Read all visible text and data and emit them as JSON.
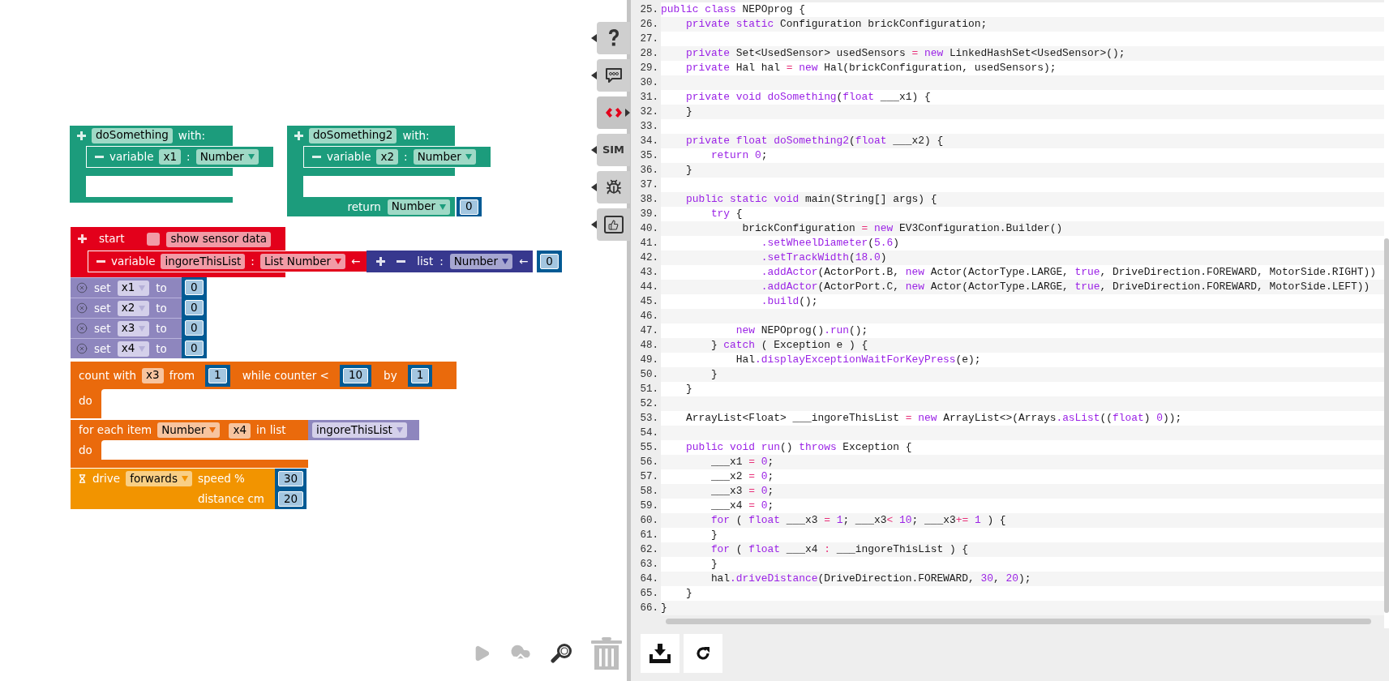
{
  "functions": [
    {
      "name": "doSomething",
      "with": "with:",
      "parameter": {
        "label": "variable",
        "name": "x1",
        "separator": ":",
        "type": "Number"
      }
    },
    {
      "name": "doSomething2",
      "with": "with:",
      "parameter": {
        "label": "variable",
        "name": "x2",
        "separator": ":",
        "type": "Number"
      },
      "return": {
        "label": "return",
        "type": "Number",
        "value": "0"
      }
    }
  ],
  "start": {
    "label": "start",
    "show_sensor_data": {
      "checked": false,
      "label": "show sensor data"
    },
    "variable": {
      "label": "variable",
      "name": "ingoreThisList",
      "separator": ":",
      "type": "List Number",
      "arrow": "←",
      "list": {
        "label": "list",
        "separator": ":",
        "type": "Number",
        "arrow": "←",
        "value": "0"
      }
    }
  },
  "set_blocks": [
    {
      "label": "set",
      "variable": "x1",
      "to": "to",
      "value": "0"
    },
    {
      "label": "set",
      "variable": "x2",
      "to": "to",
      "value": "0"
    },
    {
      "label": "set",
      "variable": "x3",
      "to": "to",
      "value": "0"
    },
    {
      "label": "set",
      "variable": "x4",
      "to": "to",
      "value": "0"
    }
  ],
  "count_loop": {
    "label": "count with",
    "variable": "x3",
    "from": "from",
    "start": "1",
    "condition": "while counter <",
    "end": "10",
    "by": "by",
    "step": "1",
    "do": "do"
  },
  "for_each": {
    "label": "for each item",
    "type": "Number",
    "variable": "x4",
    "in_list": "in list",
    "list": "ingoreThisList",
    "do": "do"
  },
  "drive": {
    "label": "drive",
    "direction": "forwards",
    "speed_label": "speed %",
    "speed": "30",
    "distance_label": "distance cm",
    "distance": "20"
  },
  "tool_tabs": [
    {
      "kind": "help",
      "selected": false
    },
    {
      "kind": "comment",
      "selected": false
    },
    {
      "kind": "code",
      "selected": true
    },
    {
      "kind": "sim",
      "label": "SIM",
      "selected": false
    },
    {
      "kind": "debug",
      "selected": false
    },
    {
      "kind": "feedback",
      "selected": false
    }
  ],
  "code": {
    "lines": [
      {
        "number": "25.",
        "tokens": [
          {
            "kind": "kw",
            "text": "public class"
          },
          {
            "kind": "txt",
            "text": " NEPOprog {"
          }
        ]
      },
      {
        "number": "26.",
        "tokens": [
          {
            "kind": "kw",
            "text": "    private static"
          },
          {
            "kind": "txt",
            "text": " Configuration brickConfiguration;"
          }
        ]
      },
      {
        "number": "27."
      },
      {
        "number": "28.",
        "tokens": [
          {
            "kind": "kw",
            "text": "    private"
          },
          {
            "kind": "txt",
            "text": " Set<UsedSensor> usedSensors "
          },
          {
            "kind": "op",
            "text": "="
          },
          {
            "kind": "kw",
            "text": " new"
          },
          {
            "kind": "txt",
            "text": " LinkedHashSet<UsedSensor>();"
          }
        ]
      },
      {
        "number": "29.",
        "tokens": [
          {
            "kind": "kw",
            "text": "    private"
          },
          {
            "kind": "txt",
            "text": " Hal hal "
          },
          {
            "kind": "op",
            "text": "="
          },
          {
            "kind": "kw",
            "text": " new"
          },
          {
            "kind": "txt",
            "text": " Hal(brickConfiguration, usedSensors);"
          }
        ]
      },
      {
        "number": "30."
      },
      {
        "number": "31.",
        "tokens": [
          {
            "kind": "kw",
            "text": "    private void doSomething"
          },
          {
            "kind": "txt",
            "text": "("
          },
          {
            "kind": "kw",
            "text": "float"
          },
          {
            "kind": "txt",
            "text": " ___x1) {"
          }
        ]
      },
      {
        "number": "32.",
        "tokens": [
          {
            "kind": "txt",
            "text": "    }"
          }
        ]
      },
      {
        "number": "33."
      },
      {
        "number": "34.",
        "tokens": [
          {
            "kind": "kw",
            "text": "    private float doSomething2"
          },
          {
            "kind": "txt",
            "text": "("
          },
          {
            "kind": "kw",
            "text": "float"
          },
          {
            "kind": "txt",
            "text": " ___x2) {"
          }
        ]
      },
      {
        "number": "35.",
        "tokens": [
          {
            "kind": "kw",
            "text": "        return 0"
          },
          {
            "kind": "txt",
            "text": ";"
          }
        ]
      },
      {
        "number": "36.",
        "tokens": [
          {
            "kind": "txt",
            "text": "    }"
          }
        ]
      },
      {
        "number": "37."
      },
      {
        "number": "38.",
        "tokens": [
          {
            "kind": "kw",
            "text": "    public static void"
          },
          {
            "kind": "txt",
            "text": " main(String[] args) {"
          }
        ]
      },
      {
        "number": "39.",
        "tokens": [
          {
            "kind": "kw",
            "text": "        try"
          },
          {
            "kind": "txt",
            "text": " {"
          }
        ]
      },
      {
        "number": "40.",
        "tokens": [
          {
            "kind": "txt",
            "text": "             brickConfiguration "
          },
          {
            "kind": "op",
            "text": "="
          },
          {
            "kind": "kw",
            "text": " new"
          },
          {
            "kind": "txt",
            "text": " EV3Configuration.Builder()"
          }
        ]
      },
      {
        "number": "41.",
        "tokens": [
          {
            "kind": "kw",
            "text": "                .setWheelDiameter"
          },
          {
            "kind": "txt",
            "text": "("
          },
          {
            "kind": "kw",
            "text": "5.6"
          },
          {
            "kind": "txt",
            "text": ")"
          }
        ]
      },
      {
        "number": "42.",
        "tokens": [
          {
            "kind": "kw",
            "text": "                .setTrackWidth"
          },
          {
            "kind": "txt",
            "text": "("
          },
          {
            "kind": "kw",
            "text": "18.0"
          },
          {
            "kind": "txt",
            "text": ")"
          }
        ]
      },
      {
        "number": "43.",
        "tokens": [
          {
            "kind": "kw",
            "text": "                .addActor"
          },
          {
            "kind": "txt",
            "text": "(ActorPort.B, "
          },
          {
            "kind": "kw",
            "text": "new"
          },
          {
            "kind": "txt",
            "text": " Actor(ActorType.LARGE, "
          },
          {
            "kind": "kw",
            "text": "true"
          },
          {
            "kind": "txt",
            "text": ", DriveDirection.FOREWARD, MotorSide.RIGHT))"
          }
        ]
      },
      {
        "number": "44.",
        "tokens": [
          {
            "kind": "kw",
            "text": "                .addActor"
          },
          {
            "kind": "txt",
            "text": "(ActorPort.C, "
          },
          {
            "kind": "kw",
            "text": "new"
          },
          {
            "kind": "txt",
            "text": " Actor(ActorType.LARGE, "
          },
          {
            "kind": "kw",
            "text": "true"
          },
          {
            "kind": "txt",
            "text": ", DriveDirection.FOREWARD, MotorSide.LEFT))"
          }
        ]
      },
      {
        "number": "45.",
        "tokens": [
          {
            "kind": "kw",
            "text": "                .build"
          },
          {
            "kind": "txt",
            "text": "();"
          }
        ]
      },
      {
        "number": "46."
      },
      {
        "number": "47.",
        "tokens": [
          {
            "kind": "kw",
            "text": "            new"
          },
          {
            "kind": "txt",
            "text": " NEPOprog()"
          },
          {
            "kind": "kw",
            "text": ".run"
          },
          {
            "kind": "txt",
            "text": "();"
          }
        ]
      },
      {
        "number": "48.",
        "tokens": [
          {
            "kind": "txt",
            "text": "        } "
          },
          {
            "kind": "kw",
            "text": "catch"
          },
          {
            "kind": "txt",
            "text": " ( Exception e ) {"
          }
        ]
      },
      {
        "number": "49.",
        "tokens": [
          {
            "kind": "txt",
            "text": "            Hal"
          },
          {
            "kind": "kw",
            "text": ".displayExceptionWaitForKeyPress"
          },
          {
            "kind": "txt",
            "text": "(e);"
          }
        ]
      },
      {
        "number": "50.",
        "tokens": [
          {
            "kind": "txt",
            "text": "        }"
          }
        ]
      },
      {
        "number": "51.",
        "tokens": [
          {
            "kind": "txt",
            "text": "    }"
          }
        ]
      },
      {
        "number": "52."
      },
      {
        "number": "53.",
        "tokens": [
          {
            "kind": "txt",
            "text": "    ArrayList<Float> ___ingoreThisList "
          },
          {
            "kind": "op",
            "text": "="
          },
          {
            "kind": "kw",
            "text": " new"
          },
          {
            "kind": "txt",
            "text": " ArrayList<>(Arrays"
          },
          {
            "kind": "kw",
            "text": ".asList"
          },
          {
            "kind": "txt",
            "text": "(("
          },
          {
            "kind": "kw",
            "text": "float"
          },
          {
            "kind": "txt",
            "text": ") "
          },
          {
            "kind": "kw",
            "text": "0"
          },
          {
            "kind": "txt",
            "text": "));"
          }
        ]
      },
      {
        "number": "54."
      },
      {
        "number": "55.",
        "tokens": [
          {
            "kind": "kw",
            "text": "    public void run"
          },
          {
            "kind": "txt",
            "text": "() "
          },
          {
            "kind": "kw",
            "text": "throws"
          },
          {
            "kind": "txt",
            "text": " Exception {"
          }
        ]
      },
      {
        "number": "56.",
        "tokens": [
          {
            "kind": "txt",
            "text": "        ___x1 "
          },
          {
            "kind": "op",
            "text": "="
          },
          {
            "kind": "kw",
            "text": " 0"
          },
          {
            "kind": "txt",
            "text": ";"
          }
        ]
      },
      {
        "number": "57.",
        "tokens": [
          {
            "kind": "txt",
            "text": "        ___x2 "
          },
          {
            "kind": "op",
            "text": "="
          },
          {
            "kind": "kw",
            "text": " 0"
          },
          {
            "kind": "txt",
            "text": ";"
          }
        ]
      },
      {
        "number": "58.",
        "tokens": [
          {
            "kind": "txt",
            "text": "        ___x3 "
          },
          {
            "kind": "op",
            "text": "="
          },
          {
            "kind": "kw",
            "text": " 0"
          },
          {
            "kind": "txt",
            "text": ";"
          }
        ]
      },
      {
        "number": "59.",
        "tokens": [
          {
            "kind": "txt",
            "text": "        ___x4 "
          },
          {
            "kind": "op",
            "text": "="
          },
          {
            "kind": "kw",
            "text": " 0"
          },
          {
            "kind": "txt",
            "text": ";"
          }
        ]
      },
      {
        "number": "60.",
        "tokens": [
          {
            "kind": "kw",
            "text": "        for"
          },
          {
            "kind": "txt",
            "text": " ( "
          },
          {
            "kind": "kw",
            "text": "float"
          },
          {
            "kind": "txt",
            "text": " ___x3 "
          },
          {
            "kind": "op",
            "text": "="
          },
          {
            "kind": "kw",
            "text": " 1"
          },
          {
            "kind": "txt",
            "text": "; ___x3"
          },
          {
            "kind": "op",
            "text": "<"
          },
          {
            "kind": "kw",
            "text": " 10"
          },
          {
            "kind": "txt",
            "text": "; ___x3"
          },
          {
            "kind": "op",
            "text": "+="
          },
          {
            "kind": "kw",
            "text": " 1"
          },
          {
            "kind": "txt",
            "text": " ) {"
          }
        ]
      },
      {
        "number": "61.",
        "tokens": [
          {
            "kind": "txt",
            "text": "        }"
          }
        ]
      },
      {
        "number": "62.",
        "tokens": [
          {
            "kind": "kw",
            "text": "        for"
          },
          {
            "kind": "txt",
            "text": " ( "
          },
          {
            "kind": "kw",
            "text": "float"
          },
          {
            "kind": "txt",
            "text": " ___x4 "
          },
          {
            "kind": "op",
            "text": ":"
          },
          {
            "kind": "txt",
            "text": " ___ingoreThisList ) {"
          }
        ]
      },
      {
        "number": "63.",
        "tokens": [
          {
            "kind": "txt",
            "text": "        }"
          }
        ]
      },
      {
        "number": "64.",
        "tokens": [
          {
            "kind": "txt",
            "text": "        hal"
          },
          {
            "kind": "kw",
            "text": ".driveDistance"
          },
          {
            "kind": "txt",
            "text": "(DriveDirection.FOREWARD, "
          },
          {
            "kind": "kw",
            "text": "30"
          },
          {
            "kind": "txt",
            "text": ", "
          },
          {
            "kind": "kw",
            "text": "20"
          },
          {
            "kind": "txt",
            "text": ");"
          }
        ]
      },
      {
        "number": "65.",
        "tokens": [
          {
            "kind": "txt",
            "text": "    }"
          }
        ]
      },
      {
        "number": "66.",
        "tokens": [
          {
            "kind": "txt",
            "text": "}"
          }
        ]
      }
    ]
  }
}
